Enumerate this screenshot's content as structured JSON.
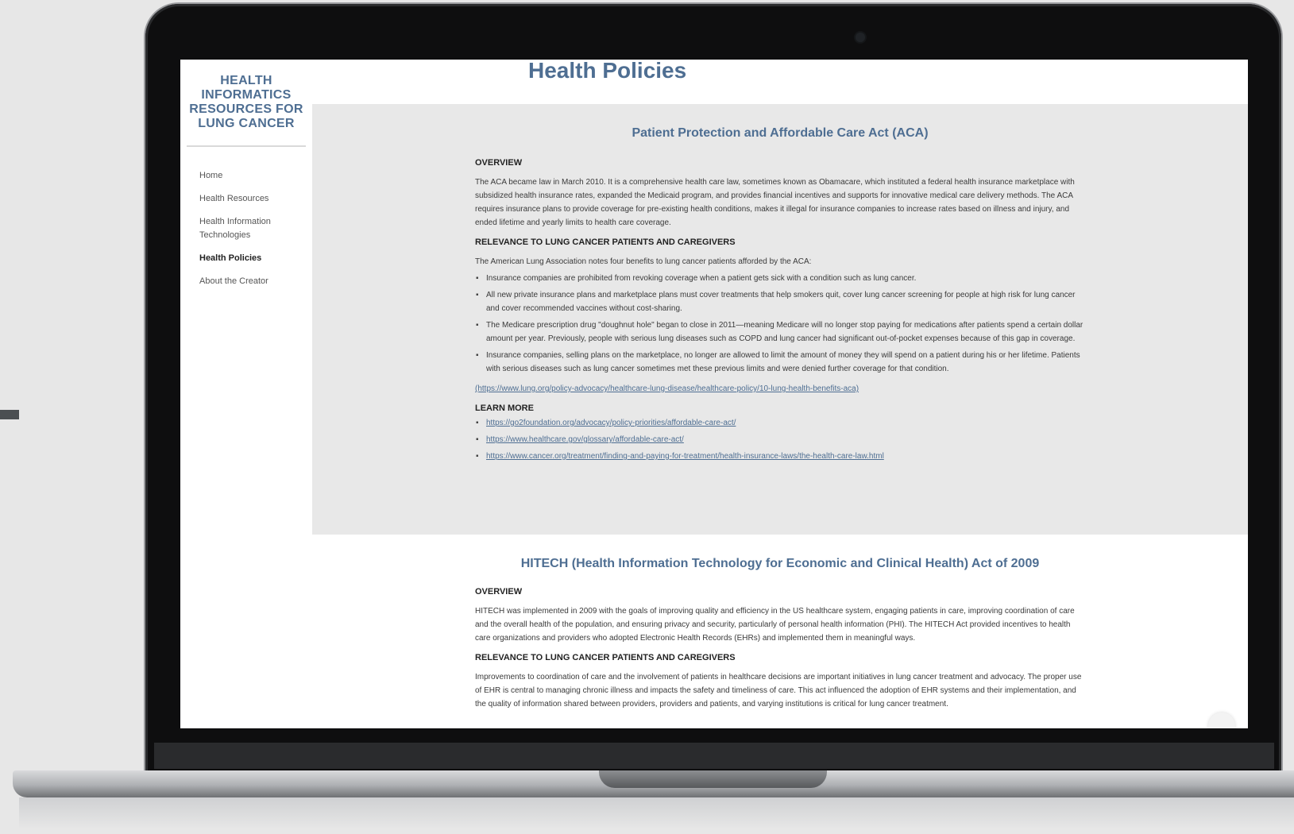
{
  "sidebar": {
    "site_title": "HEALTH INFORMATICS RESOURCES FOR LUNG CANCER",
    "nav": [
      {
        "label": "Home",
        "active": false
      },
      {
        "label": "Health Resources",
        "active": false
      },
      {
        "label": "Health Information Technologies",
        "active": false
      },
      {
        "label": "Health Policies",
        "active": true
      },
      {
        "label": "About the Creator",
        "active": false
      }
    ]
  },
  "page_title": "Health Policies",
  "aca": {
    "title": "Patient Protection and Affordable Care Act (ACA)",
    "overview_heading": "OVERVIEW",
    "overview_text": "The ACA became law in March 2010. It is a comprehensive health care law, sometimes known as Obamacare, which instituted a federal health insurance marketplace with subsidized health insurance rates, expanded the Medicaid program, and provides financial incentives and supports for innovative medical care delivery methods. The ACA requires insurance plans to provide coverage for pre-existing health conditions, makes it illegal for insurance companies to increase rates based on illness and injury, and ended lifetime and yearly limits to health care coverage.",
    "relevance_heading": "RELEVANCE TO LUNG CANCER PATIENTS AND CAREGIVERS",
    "relevance_intro": "The American Lung Association notes four benefits to lung cancer patients afforded by the ACA:",
    "benefits": [
      "Insurance companies are prohibited from revoking coverage when a patient gets sick with a condition such as lung cancer.",
      "All new private insurance plans and marketplace plans must cover treatments that help smokers quit, cover lung cancer screening for people at high risk for lung cancer and cover recommended vaccines without cost-sharing.",
      "The Medicare prescription drug \"doughnut hole\" began to close in 2011—meaning Medicare will no longer stop paying for medications after patients spend a certain dollar amount per year. Previously, people with serious lung diseases such as COPD and lung cancer had significant out-of-pocket expenses because of this gap in coverage.",
      "Insurance companies, selling plans on the marketplace, no longer are allowed to limit the amount of money they will spend on a patient during his or her lifetime. Patients with serious diseases such as lung cancer sometimes met these previous limits and were denied further coverage for that condition."
    ],
    "source_link": "(https://www.lung.org/policy-advocacy/healthcare-lung-disease/healthcare-policy/10-lung-health-benefits-aca)",
    "learn_more_heading": "LEARN MORE",
    "learn_more_links": [
      "https://go2foundation.org/advocacy/policy-priorities/affordable-care-act/",
      "https://www.healthcare.gov/glossary/affordable-care-act/",
      "https://www.cancer.org/treatment/finding-and-paying-for-treatment/health-insurance-laws/the-health-care-law.html"
    ]
  },
  "hitech": {
    "title": "HITECH (Health Information Technology for Economic and Clinical Health) Act of 2009",
    "overview_heading": "OVERVIEW",
    "overview_text": "HITECH was implemented in 2009 with the goals of improving quality and efficiency in the US healthcare system, engaging patients in care, improving coordination of care and the overall health of the population, and ensuring privacy and security, particularly of personal health information (PHI). The HITECH Act provided incentives to health care organizations and providers who adopted Electronic Health Records (EHRs) and implemented them in meaningful ways.",
    "relevance_heading": "RELEVANCE TO LUNG CANCER PATIENTS AND CAREGIVERS",
    "relevance_text": "Improvements to coordination of care and the involvement of patients in healthcare decisions are important initiatives in lung cancer treatment and advocacy. The proper use of EHR is central to managing chronic illness and impacts the safety and timeliness of care. This act influenced the adoption of EHR systems and their implementation, and the quality of information shared between providers, providers and patients, and varying institutions is critical for lung cancer treatment."
  },
  "colors": {
    "accent": "#4e6e92",
    "section_gray": "#e8e8e8"
  }
}
